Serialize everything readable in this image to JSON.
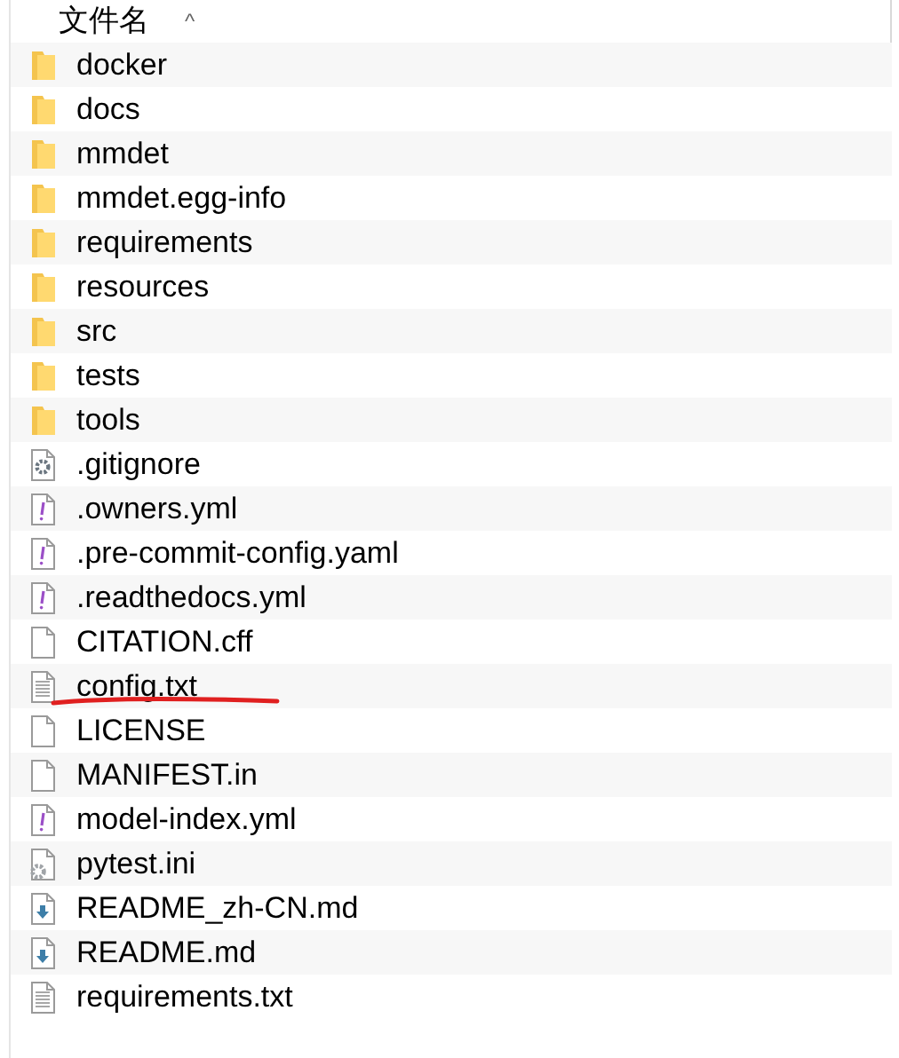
{
  "header": {
    "label": "文件名",
    "sort_caret": "^"
  },
  "files": [
    {
      "name": "docker",
      "kind": "folder",
      "underlined": false
    },
    {
      "name": "docs",
      "kind": "folder",
      "underlined": false
    },
    {
      "name": "mmdet",
      "kind": "folder",
      "underlined": false
    },
    {
      "name": "mmdet.egg-info",
      "kind": "folder",
      "underlined": false
    },
    {
      "name": "requirements",
      "kind": "folder",
      "underlined": false
    },
    {
      "name": "resources",
      "kind": "folder",
      "underlined": false
    },
    {
      "name": "src",
      "kind": "folder",
      "underlined": false
    },
    {
      "name": "tests",
      "kind": "folder",
      "underlined": false
    },
    {
      "name": "tools",
      "kind": "folder",
      "underlined": false
    },
    {
      "name": ".gitignore",
      "kind": "config",
      "underlined": false
    },
    {
      "name": ".owners.yml",
      "kind": "yaml",
      "underlined": false
    },
    {
      "name": ".pre-commit-config.yaml",
      "kind": "yaml",
      "underlined": false
    },
    {
      "name": ".readthedocs.yml",
      "kind": "yaml",
      "underlined": false
    },
    {
      "name": "CITATION.cff",
      "kind": "blank",
      "underlined": false
    },
    {
      "name": "config.txt",
      "kind": "text",
      "underlined": true
    },
    {
      "name": "LICENSE",
      "kind": "blank",
      "underlined": false
    },
    {
      "name": "MANIFEST.in",
      "kind": "blank",
      "underlined": false
    },
    {
      "name": "model-index.yml",
      "kind": "yaml",
      "underlined": false
    },
    {
      "name": "pytest.ini",
      "kind": "settings",
      "underlined": false
    },
    {
      "name": "README_zh-CN.md",
      "kind": "markdown",
      "underlined": false
    },
    {
      "name": "README.md",
      "kind": "markdown",
      "underlined": false
    },
    {
      "name": "requirements.txt",
      "kind": "text",
      "underlined": false
    }
  ]
}
